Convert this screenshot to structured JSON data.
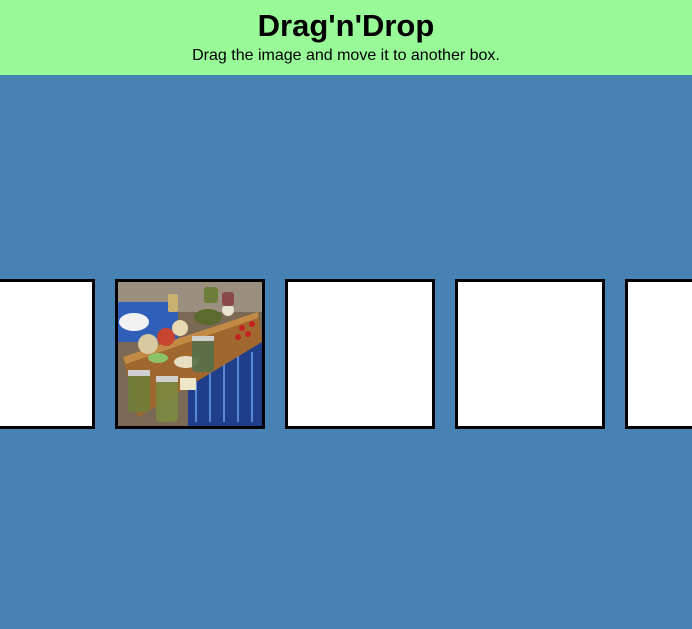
{
  "header": {
    "title": "Drag'n'Drop",
    "subtitle": "Drag the image and move it to another box."
  },
  "boxes": [
    {
      "has_image": false
    },
    {
      "has_image": true,
      "image": "food-photo"
    },
    {
      "has_image": false
    },
    {
      "has_image": false
    },
    {
      "has_image": false
    }
  ],
  "colors": {
    "header_bg": "#98fb98",
    "page_bg": "#4682b4",
    "box_bg": "#ffffff",
    "box_border": "#000000"
  }
}
